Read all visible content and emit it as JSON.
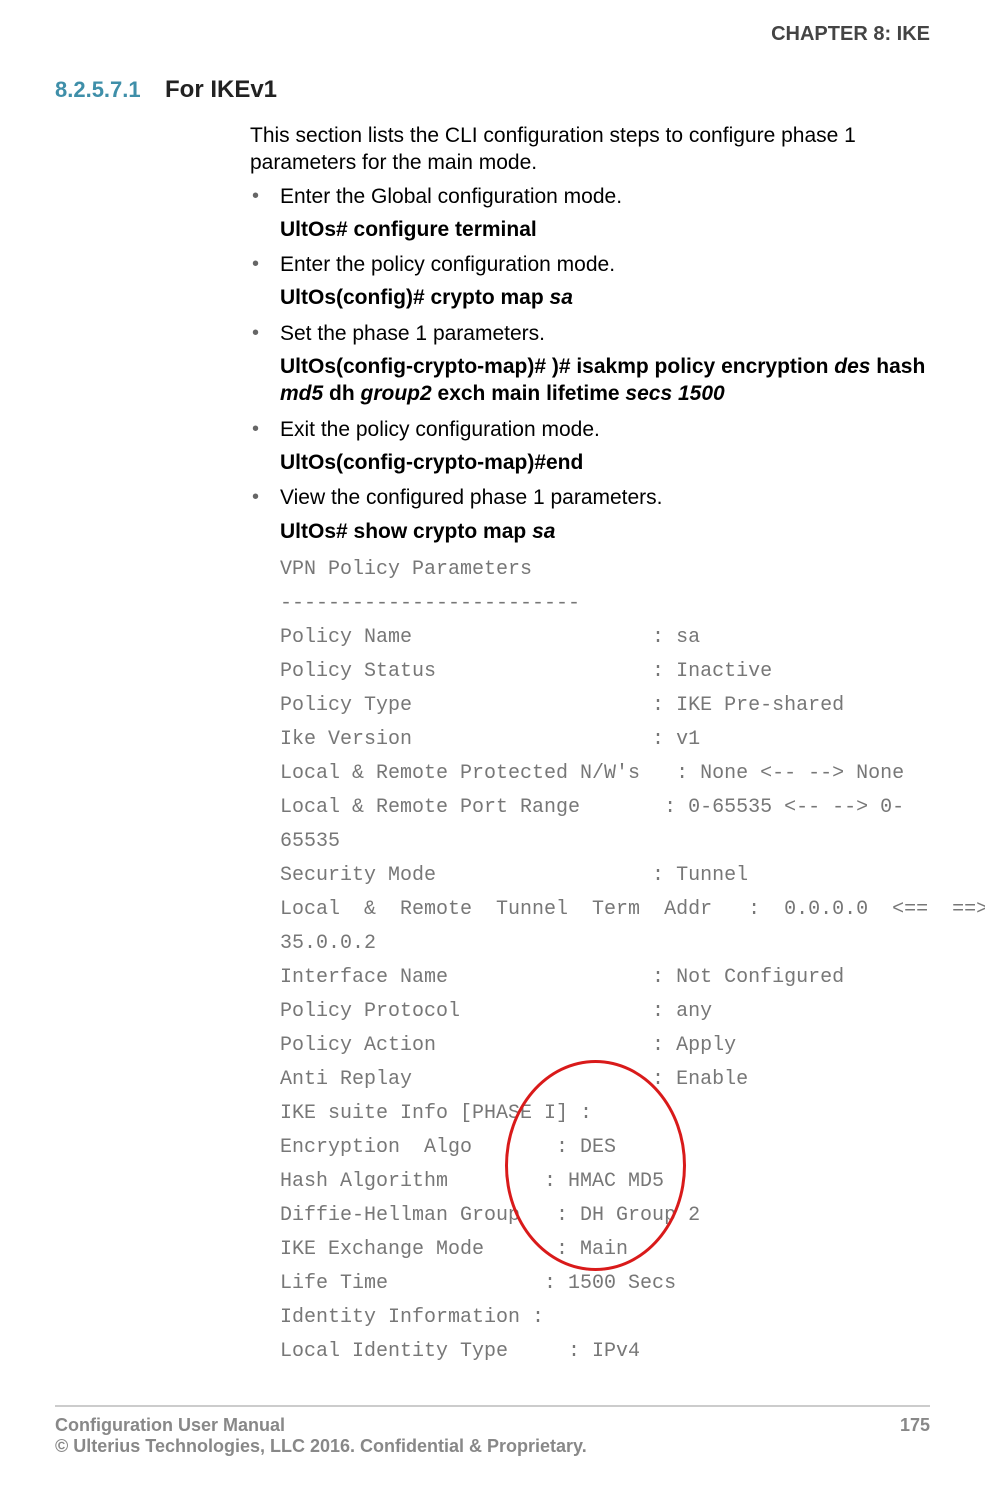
{
  "header": {
    "chapter": "CHAPTER 8: IKE"
  },
  "section": {
    "number": "8.2.5.7.1",
    "title": "For IKEv1"
  },
  "intro": "This section lists the CLI configuration steps to configure phase 1 parameters for the main mode.",
  "steps": [
    {
      "text": "Enter the Global configuration mode.",
      "cmd_plain": "UltOs# configure terminal",
      "cmd_tail_italic": ""
    },
    {
      "text": "Enter the policy configuration mode.",
      "cmd_plain": "UltOs(config)# crypto map ",
      "cmd_tail_italic": "sa"
    },
    {
      "text": "Set the phase 1 parameters.",
      "cmd_complex": true
    },
    {
      "text": "Exit the policy configuration mode.",
      "cmd_plain": "UltOs(config-crypto-map)#end",
      "cmd_tail_italic": ""
    },
    {
      "text": "View the configured phase 1 parameters.",
      "cmd_plain": "UltOs# show crypto map ",
      "cmd_tail_italic": "sa"
    }
  ],
  "complex_cmd": {
    "p1": "UltOs(config-crypto-map)# )# isakmp policy encryption ",
    "i1": "des ",
    "p2": "hash ",
    "i2": "md5 ",
    "p3": "dh ",
    "i3": "group2 ",
    "p4": "exch main lifetime ",
    "i4": "secs 1500"
  },
  "output_lines": [
    "VPN Policy Parameters",
    "-------------------------",
    "Policy Name                    : sa",
    "Policy Status                  : Inactive",
    "Policy Type                    : IKE Pre-shared",
    "Ike Version                    : v1",
    "Local & Remote Protected N/W's   : None <-- --> None",
    "Local & Remote Port Range       : 0-65535 <-- --> 0-\n65535",
    "Security Mode                  : Tunnel",
    "Local  &  Remote  Tunnel  Term  Addr   :  0.0.0.0  <==  ==> \n35.0.0.2",
    "Interface Name                 : Not Configured",
    "Policy Protocol                : any",
    "Policy Action                  : Apply",
    "Anti Replay                    : Enable",
    "IKE suite Info [PHASE I] :",
    "Encryption  Algo       : DES",
    "Hash Algorithm        : HMAC MD5",
    "Diffie-Hellman Group   : DH Group 2",
    "IKE Exchange Mode      : Main",
    "Life Time             : 1500 Secs",
    "Identity Information :",
    "Local Identity Type     : IPv4"
  ],
  "footer": {
    "left_line1": "Configuration User Manual",
    "left_line2": "© Ulterius Technologies, LLC 2016. Confidential & Proprietary.",
    "page": "175"
  }
}
